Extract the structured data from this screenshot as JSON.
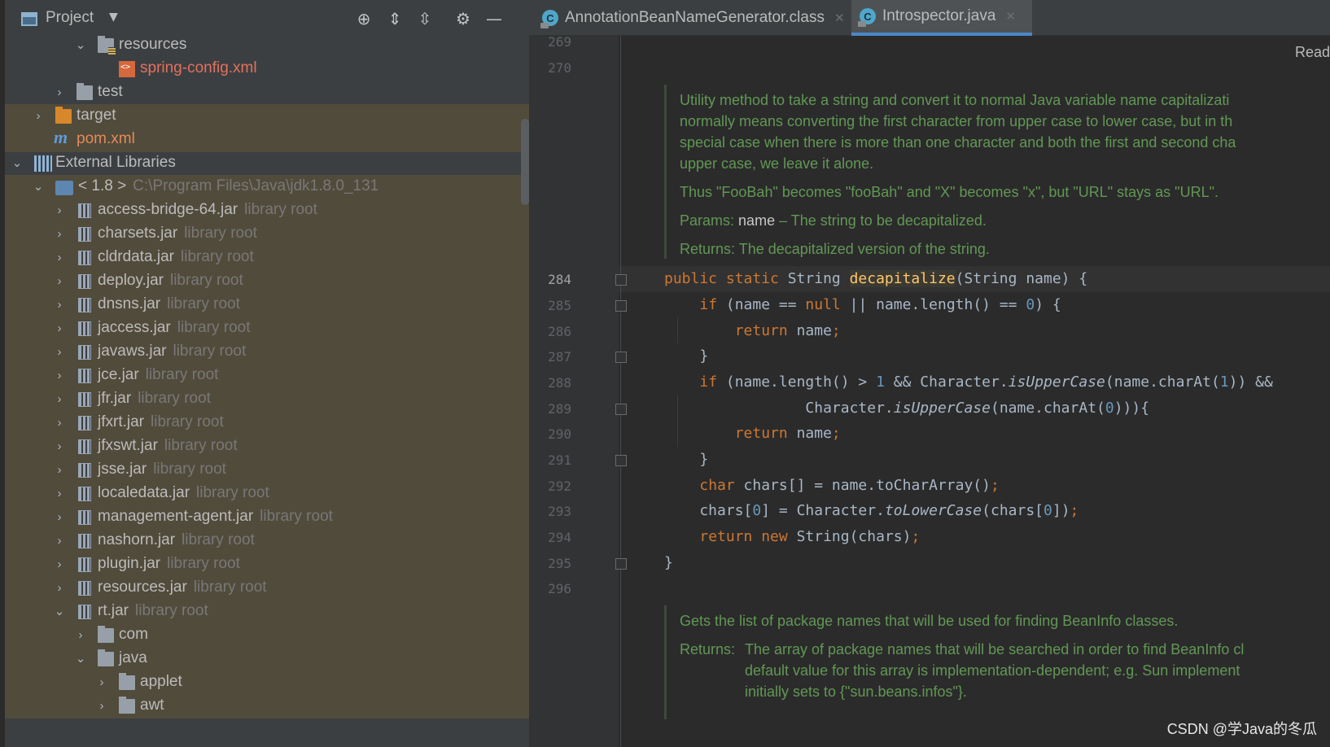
{
  "project_panel": {
    "title": "Project",
    "tree": [
      {
        "label": "resources",
        "expanded": true,
        "icon": "resources-folder-icon"
      },
      {
        "label": "spring-config.xml",
        "icon": "xml-file-icon",
        "color": "#e2715f"
      },
      {
        "label": "test",
        "expanded": false,
        "icon": "folder-icon"
      },
      {
        "label": "target",
        "expanded": false,
        "icon": "excluded-folder-icon"
      },
      {
        "label": "pom.xml",
        "icon": "maven-icon",
        "color": "#e2715f"
      },
      {
        "label": "External Libraries",
        "expanded": true,
        "icon": "libraries-icon"
      },
      {
        "label": "< 1.8 >",
        "suffix": "C:\\Program Files\\Java\\jdk1.8.0_131",
        "expanded": true,
        "icon": "jdk-icon"
      },
      {
        "label": "access-bridge-64.jar",
        "suffix": "library root"
      },
      {
        "label": "charsets.jar",
        "suffix": "library root"
      },
      {
        "label": "cldrdata.jar",
        "suffix": "library root"
      },
      {
        "label": "deploy.jar",
        "suffix": "library root"
      },
      {
        "label": "dnsns.jar",
        "suffix": "library root"
      },
      {
        "label": "jaccess.jar",
        "suffix": "library root"
      },
      {
        "label": "javaws.jar",
        "suffix": "library root"
      },
      {
        "label": "jce.jar",
        "suffix": "library root"
      },
      {
        "label": "jfr.jar",
        "suffix": "library root"
      },
      {
        "label": "jfxrt.jar",
        "suffix": "library root"
      },
      {
        "label": "jfxswt.jar",
        "suffix": "library root"
      },
      {
        "label": "jsse.jar",
        "suffix": "library root"
      },
      {
        "label": "localedata.jar",
        "suffix": "library root"
      },
      {
        "label": "management-agent.jar",
        "suffix": "library root"
      },
      {
        "label": "nashorn.jar",
        "suffix": "library root"
      },
      {
        "label": "plugin.jar",
        "suffix": "library root"
      },
      {
        "label": "resources.jar",
        "suffix": "library root"
      },
      {
        "label": "rt.jar",
        "suffix": "library root",
        "expanded": true
      },
      {
        "label": "com",
        "expanded": false,
        "icon": "package-folder-icon"
      },
      {
        "label": "java",
        "expanded": true,
        "icon": "package-folder-icon"
      },
      {
        "label": "applet",
        "expanded": false,
        "icon": "package-folder-icon"
      },
      {
        "label": "awt",
        "expanded": false,
        "icon": "package-folder-icon"
      }
    ]
  },
  "editor": {
    "tabs": [
      {
        "label": "AnnotationBeanNameGenerator.class",
        "active": false
      },
      {
        "label": "Introspector.java",
        "active": true
      }
    ],
    "reader_mode": "Read",
    "line_numbers": [
      "269",
      "270",
      "284",
      "285",
      "286",
      "287",
      "288",
      "289",
      "290",
      "291",
      "292",
      "293",
      "294",
      "295",
      "296"
    ],
    "doc1": {
      "lines": [
        "Utility method to take a string and convert it to normal Java variable name capitalizati",
        "normally means converting the first character from upper case to lower case, but in th",
        "special case when there is more than one character and both the first and second cha",
        "upper case, we leave it alone."
      ],
      "example": "Thus \"FooBah\" becomes \"fooBah\" and \"X\" becomes \"x\", but \"URL\" stays as \"URL\".",
      "params_tag": "Params:",
      "param_name": "name",
      "param_desc": " – The string to be decapitalized.",
      "returns_tag": "Returns:",
      "returns_desc": "The decapitalized version of the string."
    },
    "doc2": {
      "summary": "Gets the list of package names that will be used for finding BeanInfo classes.",
      "returns_tag": "Returns:",
      "returns_lines": [
        "The array of package names that will be searched in order to find BeanInfo cl",
        "default value for this array is implementation-dependent; e.g. Sun implement",
        "initially sets to {\"sun.beans.infos\"}."
      ]
    }
  },
  "watermark": "CSDN @学Java的冬瓜"
}
